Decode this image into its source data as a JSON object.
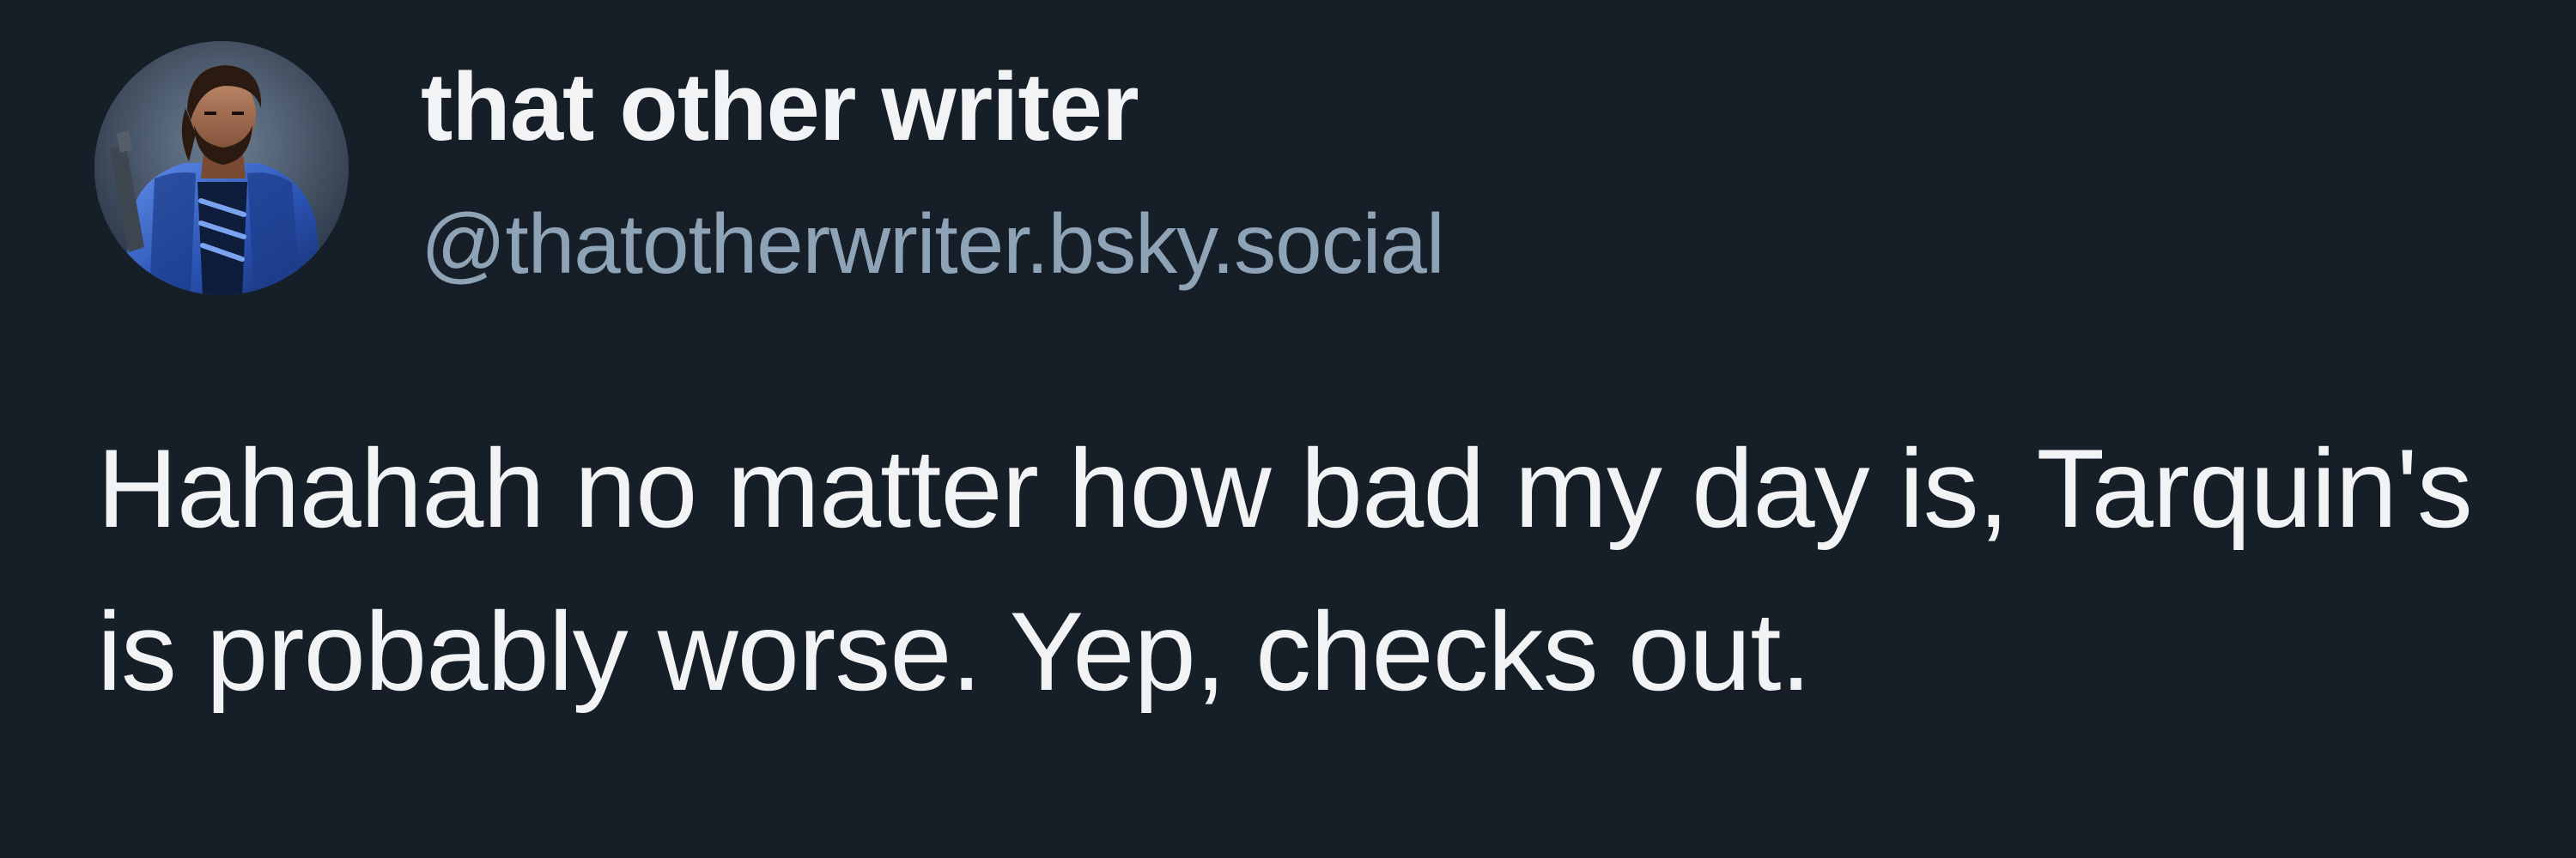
{
  "post": {
    "author": {
      "display_name": "that other writer",
      "handle": "@thatotherwriter.bsky.social",
      "avatar_icon": "armored-warrior-avatar"
    },
    "text": "Hahahah no matter how bad my day is, Tarquin's is probably worse. Yep, checks out."
  },
  "colors": {
    "background": "#161e27",
    "text_primary": "#f1f3f5",
    "text_secondary": "#8ea3b6"
  }
}
